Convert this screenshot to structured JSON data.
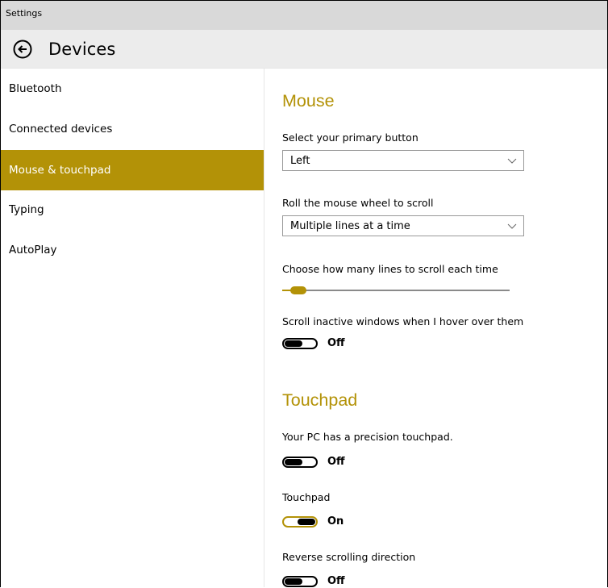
{
  "window": {
    "title": "Settings"
  },
  "header": {
    "title": "Devices"
  },
  "sidebar": {
    "items": [
      {
        "label": "Bluetooth"
      },
      {
        "label": "Connected devices"
      },
      {
        "label": "Mouse & touchpad"
      },
      {
        "label": "Typing"
      },
      {
        "label": "AutoPlay"
      }
    ],
    "selected": "Mouse & touchpad"
  },
  "mouse": {
    "title": "Mouse",
    "primary_button": {
      "label": "Select your primary button",
      "value": "Left"
    },
    "wheel_scroll": {
      "label": "Roll the mouse wheel to scroll",
      "value": "Multiple lines at a time"
    },
    "lines_to_scroll": {
      "label": "Choose how many lines to scroll each time",
      "fraction": 0.07
    },
    "inactive_scroll": {
      "label": "Scroll inactive windows when I hover over them",
      "state": "Off"
    }
  },
  "touchpad": {
    "title": "Touchpad",
    "precision": {
      "label": "Your PC has a precision touchpad.",
      "state": "Off"
    },
    "touchpad_toggle": {
      "label": "Touchpad",
      "state": "On"
    },
    "reverse_scrolling": {
      "label": "Reverse scrolling direction",
      "state": "Off"
    }
  },
  "colors": {
    "accent": "#b39207",
    "title_bar": "#d9d9d9",
    "header_bar": "#ececec"
  },
  "icons": {
    "back": "back-arrow-circle-icon",
    "dropdown": "chevron-down-icon"
  }
}
